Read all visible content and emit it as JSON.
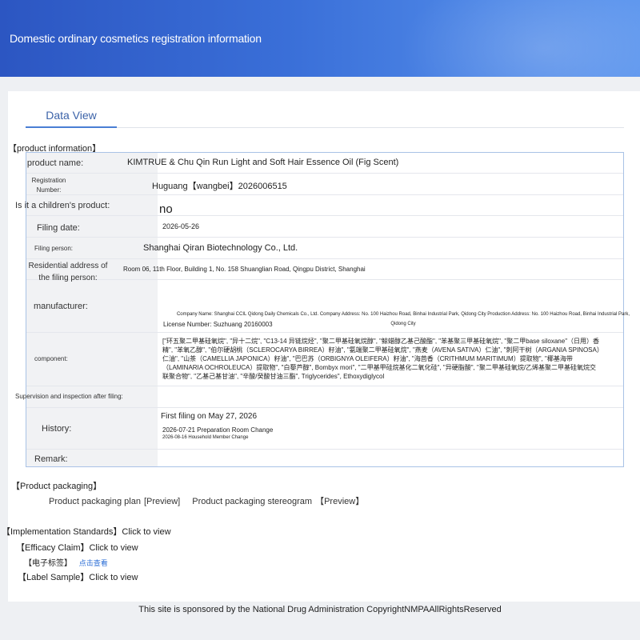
{
  "header": {
    "title": "Domestic ordinary cosmetics registration information"
  },
  "tabs": [
    {
      "label": "Data View"
    }
  ],
  "sections": {
    "product_information": "【product information】",
    "product_packaging": "【Product packaging】",
    "implementation_standards": "【Implementation Standards】Click to view",
    "efficacy_claim": "【Efficacy Claim】Click to view",
    "electronic_label": "【电子标签】",
    "electronic_label_link": "点击查看",
    "label_sample": "【Label Sample】Click to view"
  },
  "info_rows": {
    "product_name": {
      "label": "product name:",
      "value": "KIMTRUE & Chu Qin Run Light and Soft Hair Essence Oil (Fig Scent)"
    },
    "registration_number": {
      "label": "Registration Number:",
      "value": "Huguang【wangbei】2026006515"
    },
    "childrens_product": {
      "label": "Is it a children's product:",
      "value": "no"
    },
    "filing_date": {
      "label": "Filing date:",
      "value": "2026-05-26"
    },
    "filing_person": {
      "label": "Filing person:",
      "value": "Shanghai Qiran Biotechnology Co., Ltd."
    },
    "residential_address": {
      "label": "Residential address of the filing person:",
      "value": "Room 06, 11th Floor, Building 1, No. 158 Shuanglian Road, Qingpu District, Shanghai"
    },
    "manufacturer": {
      "label": "manufacturer:",
      "company": "Company Name: Shanghai CCIL Qidong Daily Chemicals Co., Ltd. Company Address: No. 100 Haizhou Road, Binhai Industrial Park, Qidong City Production Address: No. 100 Haizhou Road, Binhai Industrial Park, Qidong City",
      "license": "License Number: Suzhuang 20160003"
    },
    "component": {
      "label": "component:",
      "value": "[\"环五聚二甲基硅氧烷\", \"异十二烷\", \"C13-14 异链烷烃\", \"聚二甲基硅氧烷醇\", \"鲸蜡醇乙基己酸酯\", \"苯基聚三甲基硅氧烷\", \"聚二甲base siloxane\"（日用）香精\", \"苯氧乙醇\", \"伯尔硬胡桃（SCLEROCARYA BIRREA）籽油\", \"氨端聚二甲基硅氧烷\", \"燕麦（AVENA SATIVA）仁油\", \"刺阿干树（ARGANIA SPINOSA）仁油\", \"山茶（CAMELLIA JAPONICA）籽油\", \"巴巴苏（ORBIGNYA OLEIFERA）籽油\", \"海茴香（CRITHMUM MARITIMUM）提取物\", \"椰基海带（LAMINARIA OCHROLEUCA）提取物\", \"白藜芦醇\", Bombyx mori\", \"二甲基甲硅烷基化二氧化硅\", \"异硬脂酸\", \"聚二甲基硅氧烷/乙烯基聚二甲基硅氧烷交联聚合物\", \"乙基己基甘油\", \"辛酸/癸酸甘油三酯\", Triglycerides\", Ethoxydiglycol"
    },
    "supervision": {
      "label": "Supervision and inspection after filing:",
      "value": ""
    },
    "history": {
      "label": "History:",
      "first_filing": "First filing on May 27, 2026",
      "change_1": "2026-07-21 Preparation Room Change",
      "change_2": "2026-08-16 Household Member Change"
    },
    "remark": {
      "label": "Remark:",
      "value": ""
    }
  },
  "packaging": {
    "plan_label": "Product packaging plan",
    "plan_link": "[Preview]",
    "stereogram_label": "Product packaging stereogram",
    "stereogram_link": "【Preview】"
  },
  "footer": {
    "text": "This site is sponsored by the National Drug Administration CopyrightNMPAAllRightsReserved"
  }
}
